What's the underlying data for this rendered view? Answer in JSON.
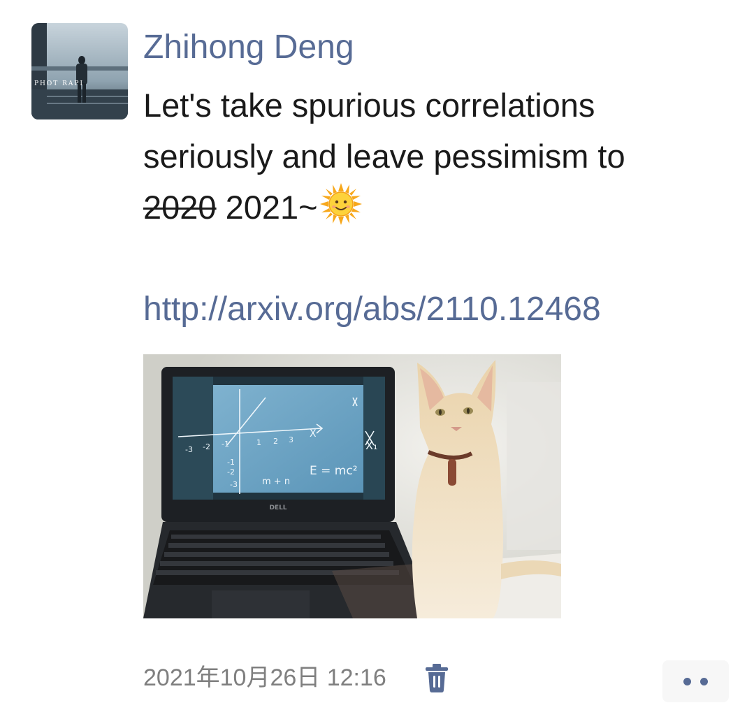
{
  "post": {
    "author": "Zhihong Deng",
    "avatar_text": "PHOTOGRAPH",
    "text_line1": "Let's take spurious correlations",
    "text_line2": "seriously and leave pessimism to",
    "text_struck": "2020",
    "text_after": "2021~",
    "emoji": "sun-with-face",
    "link": "http://arxiv.org/abs/2110.12468",
    "timestamp": "2021年10月26日 12:16"
  },
  "image": {
    "screen_math": "E = mc²",
    "screen_vars": "m + n",
    "laptop_brand": "DELL",
    "x_label": "X",
    "x1_label": "X₁"
  },
  "icons": {
    "delete": "trash-icon",
    "more": "more-dots-icon"
  },
  "colors": {
    "link": "#576b95",
    "text": "#1a1a1a",
    "meta": "#7f7f7f"
  }
}
